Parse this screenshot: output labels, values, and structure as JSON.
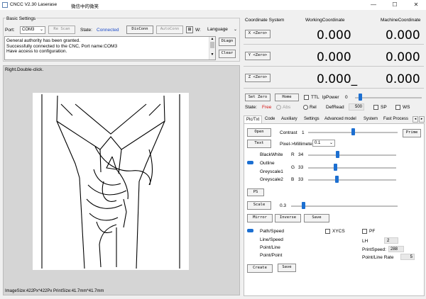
{
  "window": {
    "title": "CNCC V2.30  Laserase",
    "extra_title": "微信中的微笑",
    "controls": [
      "—",
      "☐",
      "✕"
    ]
  },
  "basic": {
    "label": "Basic Settings",
    "port_label": "Port:",
    "port_value": "COM3",
    "re_scan": "Re Scan",
    "state_label": "State:",
    "state_value": "Connected",
    "dis_conn": "DisConn",
    "auto_conn": "AutoConn",
    "w_label": "W:",
    "language": "Language",
    "log": [
      "General authority has been granted.",
      "Successfully connected to the CNC, Port name:COM3",
      "Have access to configuration."
    ],
    "diagn": "Diagn",
    "clear": "Clear"
  },
  "image_panel": {
    "hint": "Right.Double-click.",
    "footer": "ImageSize:422Px*422Px  PrintSize:41.7mm*41.7mm"
  },
  "coordinate": {
    "header": "Coordinate System",
    "working": "WorkingCoordinate",
    "machine": "MachineCoordinate",
    "rows": [
      {
        "axis": "X <Zero>",
        "working": "0.000",
        "machine": "0.000"
      },
      {
        "axis": "Y <Zero>",
        "working": "0.000",
        "machine": "0.000"
      },
      {
        "axis": "Z <Zero>",
        "working": "0.000_",
        "machine": "0.000"
      }
    ]
  },
  "controls_row": {
    "set_zero": "Set Zero",
    "home": "Home",
    "ttl": "TTL",
    "lpower": "lpPower",
    "lpower_value": "0",
    "state_label": "State:",
    "state_value": "Free",
    "abs": "Abs",
    "rel": "Rel",
    "defread": "DefRead",
    "defread_value": "500",
    "sp": "SP",
    "ws": "WS"
  },
  "tabs": [
    "Pic/Txt",
    "Code",
    "Auxiliary",
    "Settings",
    "Advanced model",
    "System",
    "Fast Process"
  ],
  "pic": {
    "open": "Open",
    "contrast_label": "Contrast",
    "contrast_value": "1",
    "prime": "Prime",
    "text": "Text",
    "pixel_label": "Pixel->Millimeter",
    "pixel_value": "0.1",
    "modes": [
      "BlackWhite",
      "Outline",
      "Greyscale1",
      "Greyscale2"
    ],
    "r_label": "R",
    "r_value": "34",
    "g_label": "G",
    "g_value": "33",
    "b_label": "B",
    "b_value": "33",
    "ps": "PS",
    "scale": "Scale",
    "scale_value": "0.3",
    "mirror": "Mirror",
    "inverse": "Inverse",
    "save": "Save",
    "path_modes": [
      "Path/Speed",
      "Line/Speed",
      "Point/Line",
      "Point/Point"
    ],
    "xycs": "XYCS",
    "pf": "PF",
    "lh_label": "LH",
    "lh_value": "2",
    "printspeed_label": "PrintSpeed:",
    "printspeed_value": "288",
    "pointline_label": "Point/Line Rate",
    "pointline_value": "5",
    "create": "Create",
    "save2": "Save"
  },
  "colors": {
    "accent": "#1c6fd1",
    "connected": "#1a49c7",
    "free": "#d41515"
  }
}
